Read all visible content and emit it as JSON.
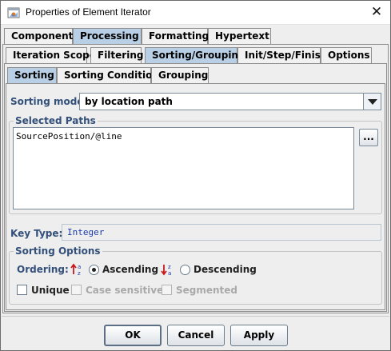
{
  "window": {
    "title": "Properties of Element Iterator",
    "close_glyph": "✕"
  },
  "tabs_level1": [
    {
      "label": "Component",
      "active": false
    },
    {
      "label": "Processing",
      "active": true
    },
    {
      "label": "Formatting",
      "active": false
    },
    {
      "label": "Hypertext",
      "active": false
    }
  ],
  "tabs_level2": [
    {
      "label": "Iteration Scope",
      "active": false
    },
    {
      "label": "Filtering",
      "active": false
    },
    {
      "label": "Sorting/Grouping",
      "active": true
    },
    {
      "label": "Init/Step/Finish",
      "active": false
    },
    {
      "label": "Options",
      "active": false
    }
  ],
  "tabs_level3": [
    {
      "label": "Sorting",
      "active": true
    },
    {
      "label": "Sorting Condition",
      "active": false
    },
    {
      "label": "Grouping",
      "active": false
    }
  ],
  "sorting_mode": {
    "label": "Sorting mode:",
    "value": "by location path"
  },
  "selected_paths": {
    "title": "Selected Paths",
    "text": "SourcePosition/@line",
    "button_label": "..."
  },
  "key_type": {
    "label": "Key Type:",
    "value": "Integer"
  },
  "sorting_options": {
    "title": "Sorting Options",
    "ordering_label": "Ordering:",
    "ascending_label": "Ascending",
    "ascending_checked": true,
    "descending_label": "Descending",
    "descending_checked": false,
    "unique_label": "Unique",
    "case_sensitive_label": "Case sensitive",
    "segmented_label": "Segmented"
  },
  "icons": {
    "app": "app-window-icon",
    "ascending": "sort-ascending-icon",
    "descending": "sort-descending-icon",
    "close": "close-icon",
    "dropdown": "chevron-down-icon"
  },
  "buttons": {
    "ok": "OK",
    "cancel": "Cancel",
    "apply": "Apply"
  },
  "colors": {
    "active_tab": "#b8cfe5",
    "label_blue": "#33507a",
    "key_value": "#1a3aa8",
    "sort_arrow": "#c8181c"
  }
}
